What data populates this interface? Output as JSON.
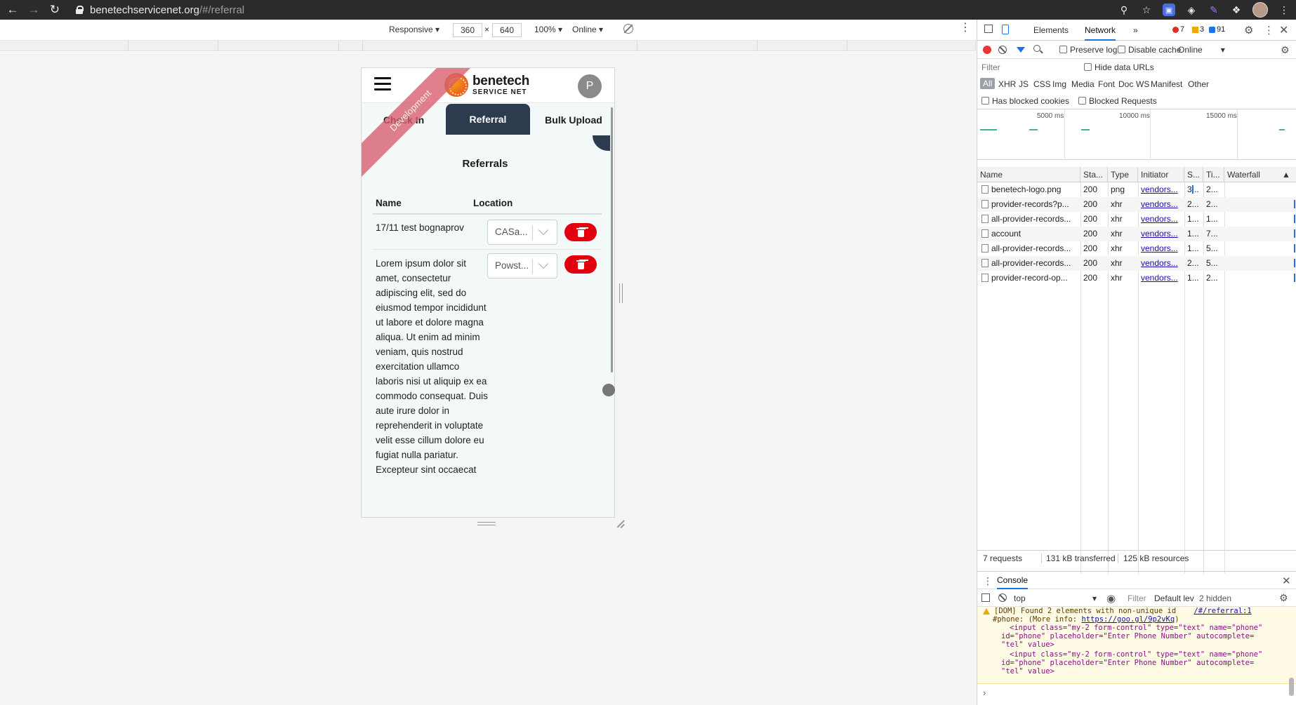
{
  "browser": {
    "url_host": "benetechservicenet.org",
    "url_path": "/#/referral"
  },
  "device_toolbar": {
    "device": "Responsive",
    "width": "360",
    "height": "640",
    "times": "×",
    "zoom": "100%",
    "throttle": "Online"
  },
  "app": {
    "logo_line1": "benetech",
    "logo_line2": "SERVICE NET",
    "user_initial": "P",
    "ribbon": "Development",
    "tabs": [
      {
        "label": "Check In"
      },
      {
        "label": "Referral"
      },
      {
        "label": "Bulk Upload"
      }
    ],
    "title": "Referrals",
    "columns": {
      "name": "Name",
      "location": "Location"
    },
    "rows": [
      {
        "name": "17/11 test bognaprov",
        "location": "CASa..."
      },
      {
        "name": "Lorem ipsum dolor sit amet, consectetur adipiscing elit, sed do eiusmod tempor incididunt ut labore et dolore magna aliqua. Ut enim ad minim veniam, quis nostrud exercitation ullamco laboris nisi ut aliquip ex ea commodo consequat. Duis aute irure dolor in reprehenderit in voluptate velit esse cillum dolore eu fugiat nulla pariatur. Excepteur sint occaecat",
        "location": "Powst..."
      }
    ]
  },
  "devtools": {
    "tabs": {
      "elements": "Elements",
      "network": "Network",
      "more": "»"
    },
    "errors": "7",
    "warnings": "3",
    "messages": "91",
    "preserve_log": "Preserve log",
    "disable_cache": "Disable cache",
    "throttle": "Online",
    "filter_placeholder": "Filter",
    "hide_data_urls": "Hide data URLs",
    "types": [
      "All",
      "XHR",
      "JS",
      "CSS",
      "Img",
      "Media",
      "Font",
      "Doc",
      "WS",
      "Manifest",
      "Other"
    ],
    "has_blocked_cookies": "Has blocked cookies",
    "blocked_requests": "Blocked Requests",
    "overview_ticks": [
      "5000 ms",
      "10000 ms",
      "15000 ms"
    ],
    "columns": [
      "Name",
      "Sta...",
      "Type",
      "Initiator",
      "S...",
      "Ti...",
      "Waterfall"
    ],
    "requests": [
      {
        "name": "benetech-logo.png",
        "status": "200",
        "type": "png",
        "initiator": "vendors...",
        "size": "3...",
        "time": "2..."
      },
      {
        "name": "provider-records?p...",
        "status": "200",
        "type": "xhr",
        "initiator": "vendors...",
        "size": "2...",
        "time": "2..."
      },
      {
        "name": "all-provider-records...",
        "status": "200",
        "type": "xhr",
        "initiator": "vendors...",
        "size": "1...",
        "time": "1..."
      },
      {
        "name": "account",
        "status": "200",
        "type": "xhr",
        "initiator": "vendors...",
        "size": "1...",
        "time": "7..."
      },
      {
        "name": "all-provider-records...",
        "status": "200",
        "type": "xhr",
        "initiator": "vendors...",
        "size": "1...",
        "time": "5..."
      },
      {
        "name": "all-provider-records...",
        "status": "200",
        "type": "xhr",
        "initiator": "vendors...",
        "size": "2...",
        "time": "5..."
      },
      {
        "name": "provider-record-op...",
        "status": "200",
        "type": "xhr",
        "initiator": "vendors...",
        "size": "1...",
        "time": "2..."
      }
    ],
    "status": {
      "requests": "7 requests",
      "transferred": "131 kB transferred",
      "resources": "125 kB resources"
    },
    "console": {
      "title": "Console",
      "context": "top",
      "filter": "Filter",
      "levels": "Default lev",
      "hidden": "2 hidden",
      "warn_line1": "[DOM] Found 2 elements with non-unique id",
      "warn_link1": "/#/referral:1",
      "warn_line2": "#phone: (More info: ",
      "warn_link2": "https://goo.gl/9p2vKq",
      "warn_line2_end": ")",
      "input_line_a": "<input class=\"my-2 form-control\" type=\"text\" name=\"phone\"",
      "input_line_b": "id=\"phone\" placeholder=\"Enter Phone Number\" autocomplete=",
      "input_line_c": "\"tel\" value>",
      "prompt": "›"
    }
  }
}
